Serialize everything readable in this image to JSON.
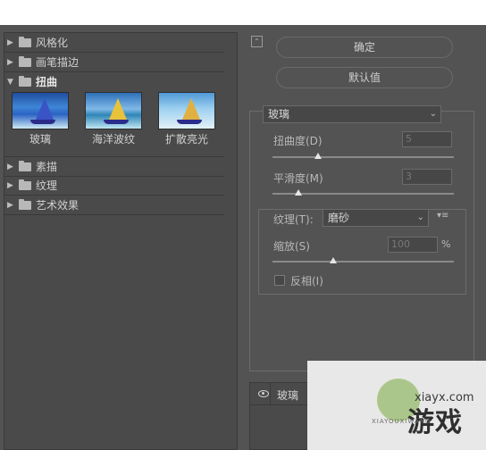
{
  "left_panel": {
    "categories": [
      {
        "label": "风格化"
      },
      {
        "label": "画笔描边"
      },
      {
        "label": "扭曲"
      },
      {
        "label": "素描"
      },
      {
        "label": "纹理"
      },
      {
        "label": "艺术效果"
      }
    ],
    "thumbnails": [
      {
        "label": "玻璃"
      },
      {
        "label": "海洋波纹"
      },
      {
        "label": "扩散亮光"
      }
    ]
  },
  "buttons": {
    "ok": "确定",
    "default": "默认值"
  },
  "settings": {
    "filter_select": "玻璃",
    "distortion": {
      "label": "扭曲度(D)",
      "value": "5",
      "level": 5,
      "max": 20
    },
    "smoothness": {
      "label": "平滑度(M)",
      "value": "3",
      "level": 3,
      "max": 15
    },
    "texture": {
      "label": "纹理(T):",
      "value": "磨砂"
    },
    "scaling": {
      "label": "缩放(S)",
      "value": "100",
      "unit": "%",
      "level": 100,
      "min": 50,
      "max": 200
    },
    "invert": {
      "label": "反相(I)",
      "checked": false
    }
  },
  "layers": {
    "effect_name": "玻璃"
  },
  "watermark": {
    "domain": "xiayx.com",
    "text": "游戏",
    "subtext": "XIAYOUXIWANG"
  }
}
